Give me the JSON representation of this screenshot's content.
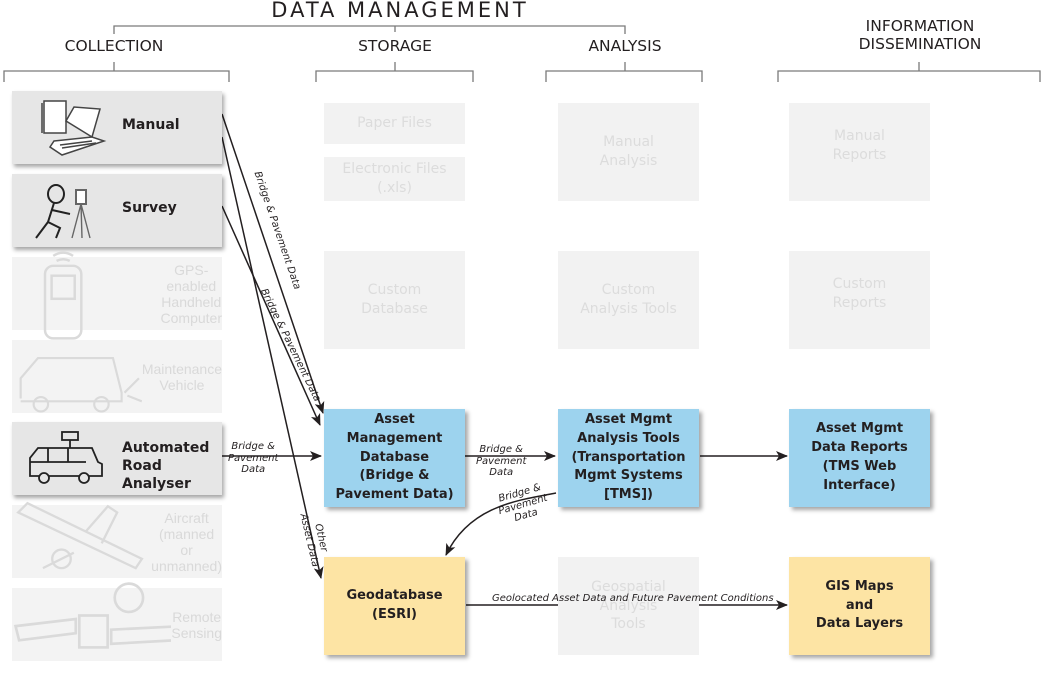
{
  "title": "DATA MANAGEMENT",
  "categories": {
    "collection": "COLLECTION",
    "storage": "STORAGE",
    "analysis": "ANALYSIS",
    "dissemination": "INFORMATION\nDISSEMINATION"
  },
  "collection": [
    {
      "label": "Manual",
      "icon": "notebook-laptop-icon",
      "active": true
    },
    {
      "label": "Survey",
      "icon": "surveyor-icon",
      "active": true
    },
    {
      "label": "GPS-enabled\nHandheld\nComputer",
      "icon": "handheld-gps-icon",
      "active": false
    },
    {
      "label": "Maintenance\nVehicle",
      "icon": "maintenance-van-icon",
      "active": false
    },
    {
      "label": "Automated\nRoad Analyser",
      "icon": "camera-van-icon",
      "active": true
    },
    {
      "label": "Aircraft\n(manned or\nunmanned)",
      "icon": "aircraft-icon",
      "active": false
    },
    {
      "label": "Remote\nSensing",
      "icon": "satellite-icon",
      "active": false
    }
  ],
  "storage": {
    "paper_files": "Paper Files",
    "electronic_files": "Electronic Files (.xls)",
    "custom_database": "Custom\nDatabase",
    "asset_db": "Asset\nManagement\nDatabase\n(Bridge &\nPavement Data)",
    "geodatabase": "Geodatabase\n(ESRI)"
  },
  "analysis": {
    "manual_analysis": "Manual\nAnalysis",
    "custom_tools": "Custom\nAnalysis Tools",
    "asset_tools": "Asset Mgmt\nAnalysis Tools\n(Transportation\nMgmt Systems\n[TMS])",
    "geospatial": "Geospatial\nAnalysis\nTools"
  },
  "dissemination": {
    "manual_reports": "Manual\nReports",
    "custom_reports": "Custom\nReports",
    "asset_reports": "Asset Mgmt\nData Reports\n(TMS Web\nInterface)",
    "gis_maps": "GIS Maps\nand\nData Layers"
  },
  "edges": {
    "manual_to_db": "Bridge & Pavement Data",
    "survey_to_db": "Bridge & Pavement Data",
    "ara_to_db": "Bridge &\nPavement\nData",
    "other_asset": "Other\nAsset Data",
    "db_to_tools": "Bridge &\nPavement\nData",
    "tools_to_geo": "Bridge &\nPavement\nData",
    "geo_to_gis": "Geolocated Asset Data and Future Pavement Conditions"
  },
  "colors": {
    "blue_box": "#9dd3ee",
    "yellow_box": "#fde4a4",
    "faded_box": "#f2f2f2",
    "active_source": "#e6e6e6"
  }
}
